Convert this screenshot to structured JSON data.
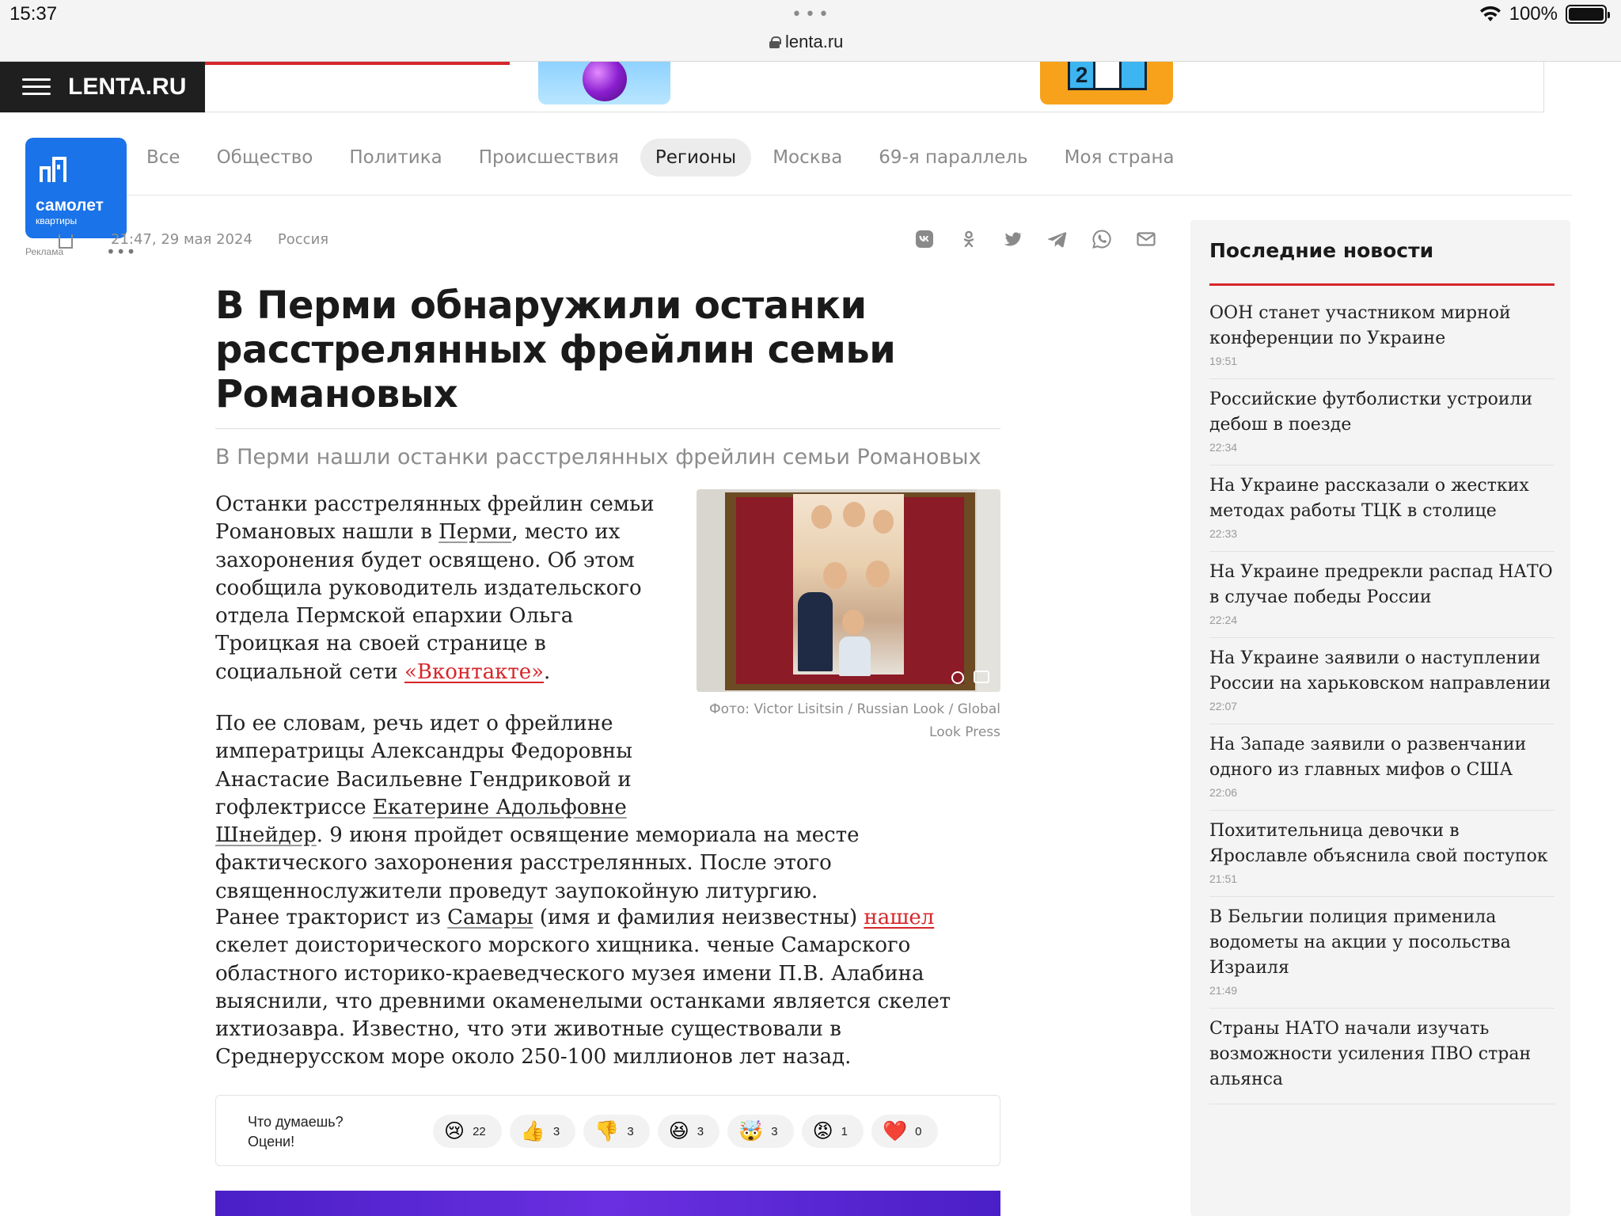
{
  "status": {
    "time": "15:37",
    "url": "lenta.ru",
    "battery": "100%",
    "battery_level": 1.0
  },
  "site": {
    "logo": "LENTA.RU"
  },
  "sponsor": {
    "name": "самолет",
    "sub": "квартиры",
    "ad_label": "Реклама"
  },
  "nav": {
    "items": [
      {
        "label": "Все"
      },
      {
        "label": "Общество"
      },
      {
        "label": "Политика"
      },
      {
        "label": "Происшествия"
      },
      {
        "label": "Регионы",
        "active": true
      },
      {
        "label": "Москва"
      },
      {
        "label": "69-я параллель"
      },
      {
        "label": "Моя страна"
      }
    ]
  },
  "article": {
    "datetime": "21:47, 29 мая 2024",
    "rubric": "Россия",
    "title": "В Перми обнаружили останки расстрелянных фрейлин семьи Романовых",
    "subtitle": "В Перми нашли останки расстрелянных фрейлин семьи Романовых",
    "photo_caption": "Фото: Victor Lisitsin / Russian Look / Global Look Press",
    "p1": {
      "t1": "Останки расстрелянных фрейлин семьи Романовых нашли в ",
      "link1": "Перми",
      "t2": ", место их захоронения будет освящено. Об этом сообщила руководитель издательского отдела Пермской епархии Ольга Троицкая на своей странице в социальной сети ",
      "link2": "«Вконтакте»",
      "t3": "."
    },
    "p2": {
      "t1": "По ее словам, речь идет о фрейлине императрицы Александры Федоровны Анастасие Васильевне Гендриковой и гофлектриссе ",
      "link1": "Екатерине Адольфовне Шнейдер",
      "t2": ". 9 июня пройдет освящение мемориала на месте фактического захоронения расстрелянных. После этого священнослужители проведут заупокойную литургию."
    },
    "p3": {
      "t1": "Ранее тракторист из ",
      "link1": "Самары",
      "t2": " (имя и фамилия неизвестны) ",
      "link2": "нашел",
      "t3": " скелет доисторического морского хищника. ченые Самарского областного историко-краеведческого музея имени П.В. Алабина выяснили, что древними окаменелыми останками является скелет ихтиозавра. Известно, что эти животные существовали в Среднерусском море около 250-100 миллионов лет назад."
    }
  },
  "reactions": {
    "label_line1": "Что думаешь?",
    "label_line2": "Оцени!",
    "items": [
      {
        "emoji": "😢",
        "icon": "crying-face-icon",
        "count": "22"
      },
      {
        "emoji": "👍",
        "icon": "thumbs-up-icon",
        "count": "3"
      },
      {
        "emoji": "👎",
        "icon": "thumbs-down-icon",
        "count": "3"
      },
      {
        "emoji": "😆",
        "icon": "laughing-face-icon",
        "count": "3"
      },
      {
        "emoji": "🤯",
        "icon": "exploding-head-icon",
        "count": "3"
      },
      {
        "emoji": "😡",
        "icon": "angry-face-icon",
        "count": "1"
      },
      {
        "emoji": "❤️",
        "icon": "heart-icon",
        "count": "0"
      }
    ]
  },
  "share_icons": [
    "vk-icon",
    "odnoklassniki-icon",
    "twitter-icon",
    "telegram-icon",
    "whatsapp-icon",
    "mail-icon"
  ],
  "sidebar": {
    "title": "Последние новости",
    "items": [
      {
        "headline": "ООН станет участником мирной конференции по Украине",
        "time": "19:51"
      },
      {
        "headline": "Российские футболистки устроили дебош в поезде",
        "time": "22:34"
      },
      {
        "headline": "На Украине рассказали о жестких методах работы ТЦК в столице",
        "time": "22:33"
      },
      {
        "headline": "На Украине предрекли распад НАТО в случае победы России",
        "time": "22:24"
      },
      {
        "headline": "На Украине заявили о наступлении России на харьковском направлении",
        "time": "22:07"
      },
      {
        "headline": "На Западе заявили о развенчании одного из главных мифов о США",
        "time": "22:06"
      },
      {
        "headline": "Похитительница девочки в Ярославле объяснила свой поступок",
        "time": "21:51"
      },
      {
        "headline": "В Бельгии полиция применила водометы на акции у посольства Израиля",
        "time": "21:49"
      },
      {
        "headline": "Страны НАТО начали изучать возможности усиления ПВО стран альянса",
        "time": ""
      }
    ]
  },
  "colors": {
    "accent": "#d6262a",
    "sponsor": "#1a73e8",
    "logo_bg": "#1f1f1f"
  }
}
